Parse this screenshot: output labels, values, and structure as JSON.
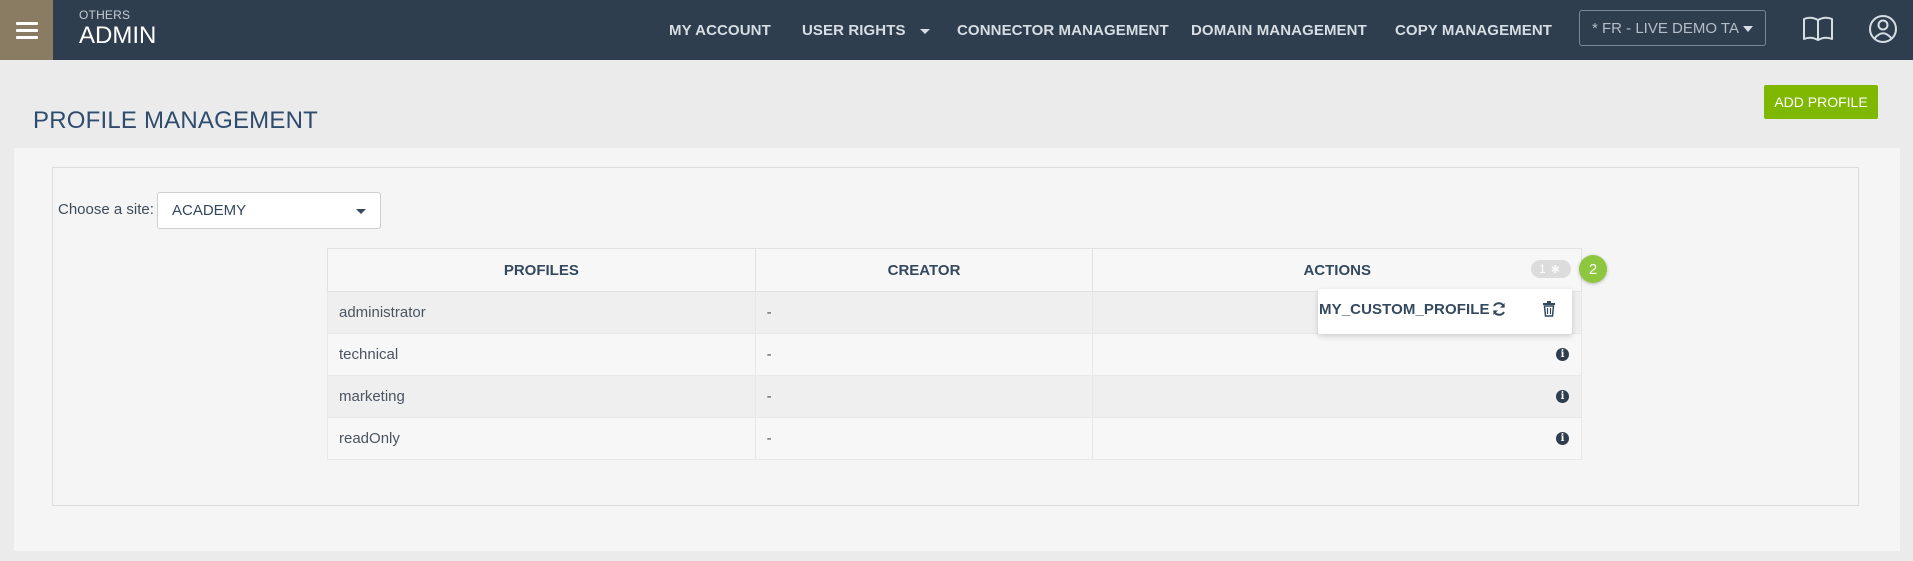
{
  "header": {
    "section_small": "OTHERS",
    "section_title": "ADMIN",
    "nav": [
      {
        "label": "MY ACCOUNT"
      },
      {
        "label": "USER RIGHTS"
      },
      {
        "label": "CONNECTOR MANAGEMENT"
      },
      {
        "label": "DOMAIN MANAGEMENT"
      },
      {
        "label": "COPY MANAGEMENT"
      }
    ],
    "site_selector": "* FR - LIVE DEMO TA",
    "icons": [
      "book-icon",
      "user-icon"
    ]
  },
  "page": {
    "title": "PROFILE MANAGEMENT",
    "add_button": "ADD PROFILE",
    "choose_site_label": "Choose a site:",
    "site_value": "ACADEMY"
  },
  "table": {
    "headers": [
      "PROFILES",
      "CREATOR",
      "ACTIONS"
    ],
    "rows": [
      {
        "profile": "administrator",
        "creator": "-"
      },
      {
        "profile": "technical",
        "creator": "-"
      },
      {
        "profile": "marketing",
        "creator": "-"
      },
      {
        "profile": "readOnly",
        "creator": "-"
      }
    ]
  },
  "custom_profiles": {
    "toggle_count": "1",
    "badge_count": "2",
    "items": [
      {
        "name": "MY_CUSTOM_PROFILE"
      }
    ]
  },
  "colors": {
    "topbar": "#2f3e4e",
    "hamburger": "#8a7b63",
    "accent_green": "#7fb800",
    "badge_green": "#8dc63f"
  }
}
